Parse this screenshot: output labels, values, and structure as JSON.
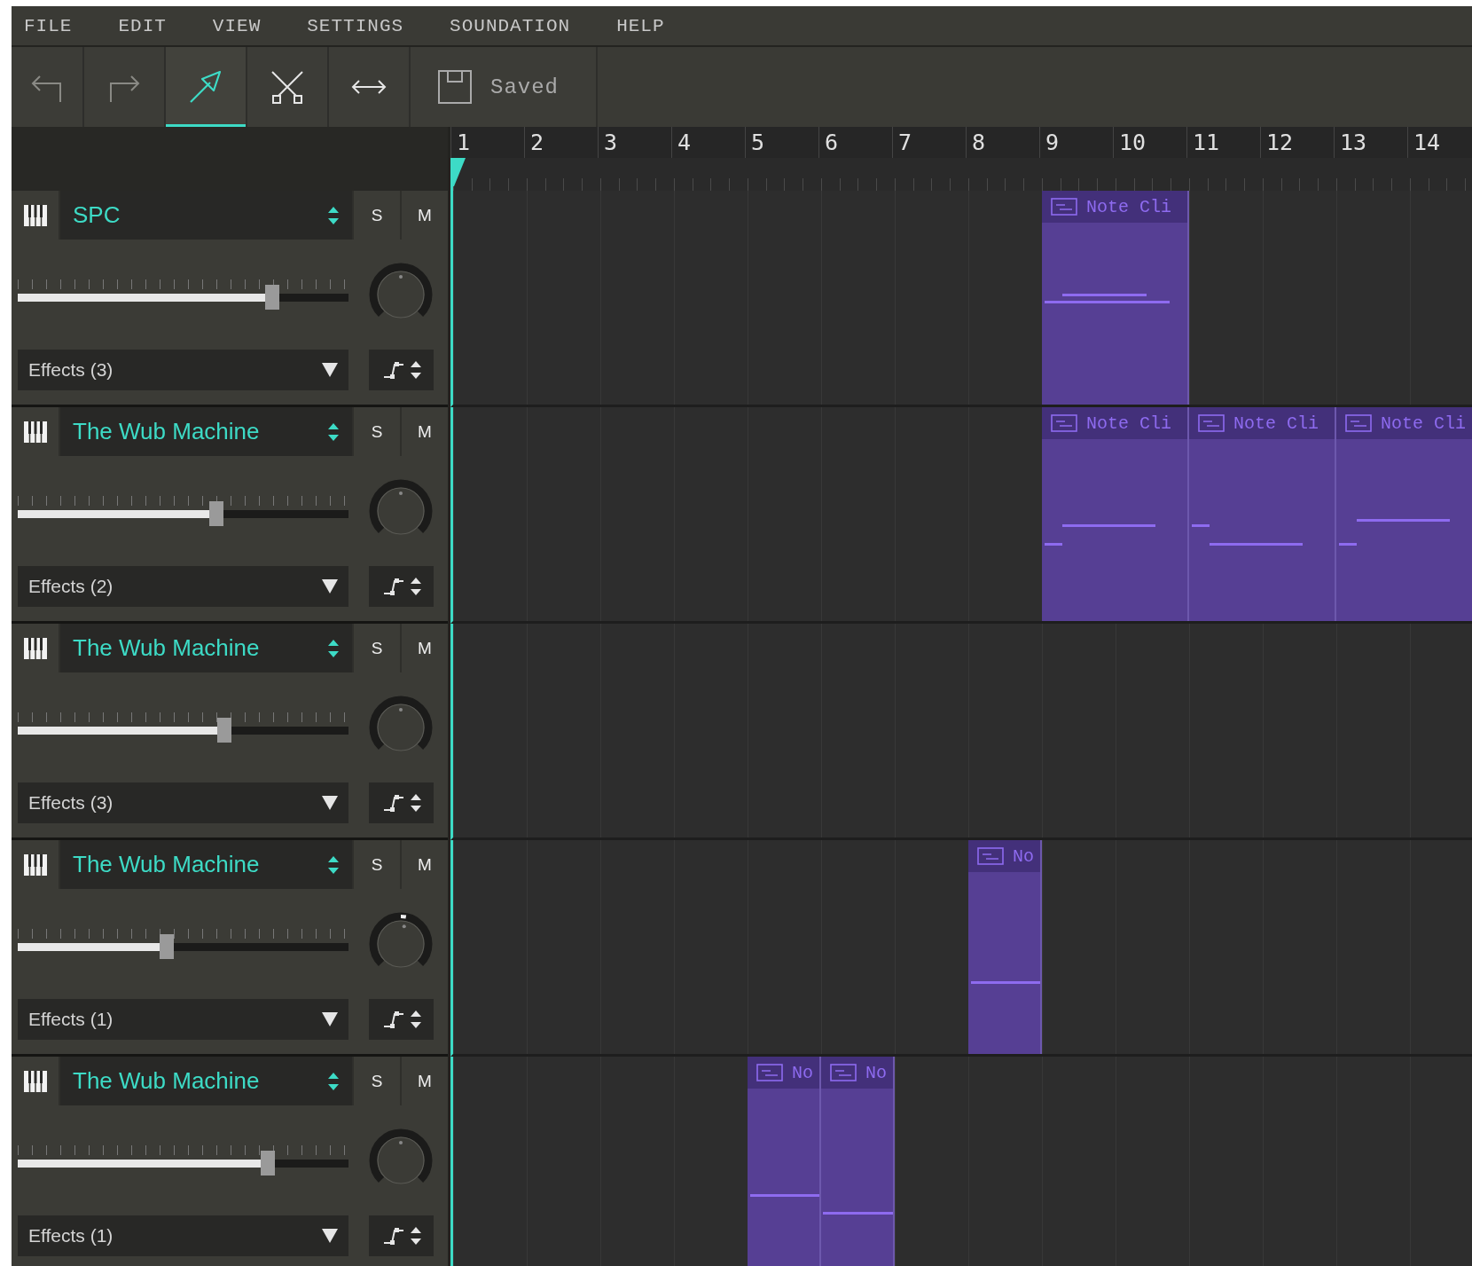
{
  "menu": [
    {
      "label": "FILE"
    },
    {
      "label": "EDIT"
    },
    {
      "label": "VIEW"
    },
    {
      "label": "SETTINGS"
    },
    {
      "label": "SOUNDATION"
    },
    {
      "label": "HELP"
    }
  ],
  "toolbar": {
    "tools": [
      {
        "kind": "undo",
        "disabled": true,
        "selected": false
      },
      {
        "kind": "redo",
        "disabled": true,
        "selected": false
      },
      {
        "kind": "pointer",
        "disabled": false,
        "selected": true
      },
      {
        "kind": "cut",
        "disabled": false,
        "selected": false
      },
      {
        "kind": "stretch",
        "disabled": false,
        "selected": false
      }
    ],
    "save": {
      "label": "Saved"
    }
  },
  "ruler": {
    "bars": [
      "1",
      "2",
      "3",
      "4",
      "5",
      "6",
      "7",
      "8",
      "9",
      "10",
      "11",
      "12",
      "13",
      "14"
    ]
  },
  "tracks": [
    {
      "name": "SPC",
      "solo": "S",
      "mute": "M",
      "volume": {
        "level": 0.77
      },
      "pan": {
        "level": 0.5
      },
      "effects": "Effects (3)",
      "clips": [
        {
          "label": "Note Cli"
        }
      ]
    },
    {
      "name": "The Wub Machine",
      "solo": "S",
      "mute": "M",
      "volume": {
        "level": 0.6
      },
      "pan": {
        "level": 0.5
      },
      "effects": "Effects (2)",
      "clips": [
        {
          "label": "Note Cli"
        },
        {
          "label": "Note Cli"
        },
        {
          "label": "Note Cli"
        }
      ]
    },
    {
      "name": "The Wub Machine",
      "solo": "S",
      "mute": "M",
      "volume": {
        "level": 0.625
      },
      "pan": {
        "level": 0.5
      },
      "effects": "Effects (3)"
    },
    {
      "name": "The Wub Machine",
      "solo": "S",
      "mute": "M",
      "volume": {
        "level": 0.45
      },
      "pan": {
        "level": 0.54
      },
      "effects": "Effects (1)",
      "clips": [
        {
          "label": "No"
        }
      ]
    },
    {
      "name": "The Wub Machine",
      "solo": "S",
      "mute": "M",
      "volume": {
        "level": 0.755
      },
      "pan": {
        "level": 0.5
      },
      "effects": "Effects (1)",
      "clips": [
        {
          "label": "No"
        },
        {
          "label": "No"
        }
      ]
    }
  ]
}
